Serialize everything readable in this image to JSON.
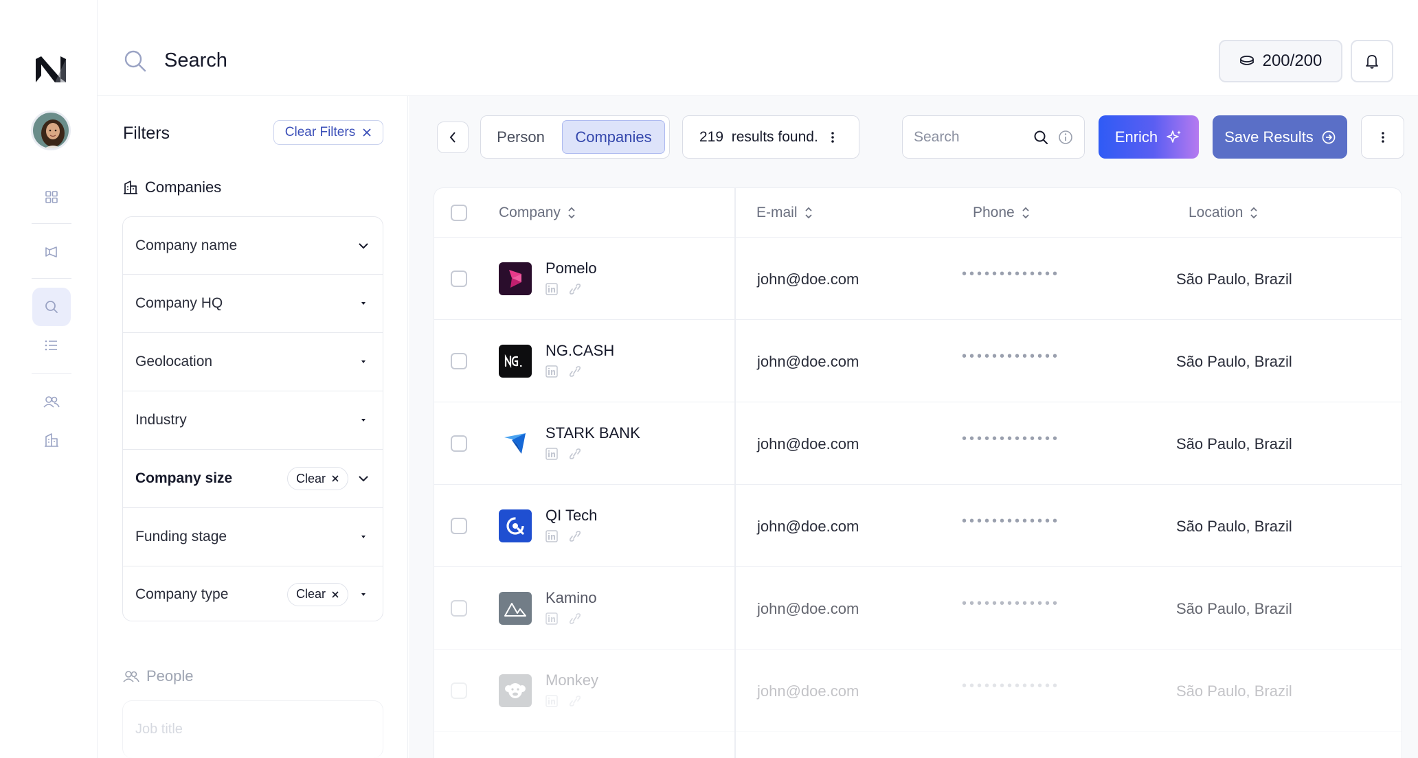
{
  "header": {
    "search_label": "Search",
    "credits": "200/200"
  },
  "filters": {
    "title": "Filters",
    "clear_filters_label": "Clear Filters",
    "companies_section": "Companies",
    "rows": [
      {
        "label": "Company name"
      },
      {
        "label": "Company HQ"
      },
      {
        "label": "Geolocation"
      },
      {
        "label": "Industry"
      },
      {
        "label": "Company size",
        "chip": "Clear"
      },
      {
        "label": "Funding stage"
      },
      {
        "label": "Company type",
        "chip": "Clear"
      }
    ],
    "people_section": "People",
    "people_first_row": "Job title"
  },
  "toolbar": {
    "tabs": [
      "Person",
      "Companies"
    ],
    "active_tab": "Companies",
    "results_text": "219  results found.",
    "search_placeholder": "Search",
    "enrich_label": "Enrich",
    "save_label": "Save Results"
  },
  "table": {
    "columns": [
      "Company",
      "E-mail",
      "Phone",
      "Location"
    ],
    "rows": [
      {
        "company": "Pomelo",
        "email": "john@doe.com",
        "phone": "•••••••••••••",
        "location": "São Paulo, Brazil"
      },
      {
        "company": "NG.CASH",
        "email": "john@doe.com",
        "phone": "•••••••••••••",
        "location": "São Paulo, Brazil"
      },
      {
        "company": "STARK BANK",
        "email": "john@doe.com",
        "phone": "•••••••••••••",
        "location": "São Paulo, Brazil"
      },
      {
        "company": "QI Tech",
        "email": "john@doe.com",
        "phone": "•••••••••••••",
        "location": "São Paulo, Brazil"
      },
      {
        "company": "Kamino",
        "email": "john@doe.com",
        "phone": "•••••••••••••",
        "location": "São Paulo, Brazil"
      },
      {
        "company": "Monkey",
        "email": "john@doe.com",
        "phone": "•••••••••••••",
        "location": "São Paulo, Brazil"
      }
    ]
  },
  "icons": {
    "logo": "app-logo",
    "rail": [
      "grid-icon",
      "megaphone-icon",
      "search-icon",
      "list-icon",
      "users-icon",
      "building-icon"
    ]
  },
  "colors": {
    "accent": "#3447ac",
    "enrich_gradient_start": "#2f5bf5",
    "enrich_gradient_end": "#b57af0",
    "save_button": "#5a6fc7"
  }
}
